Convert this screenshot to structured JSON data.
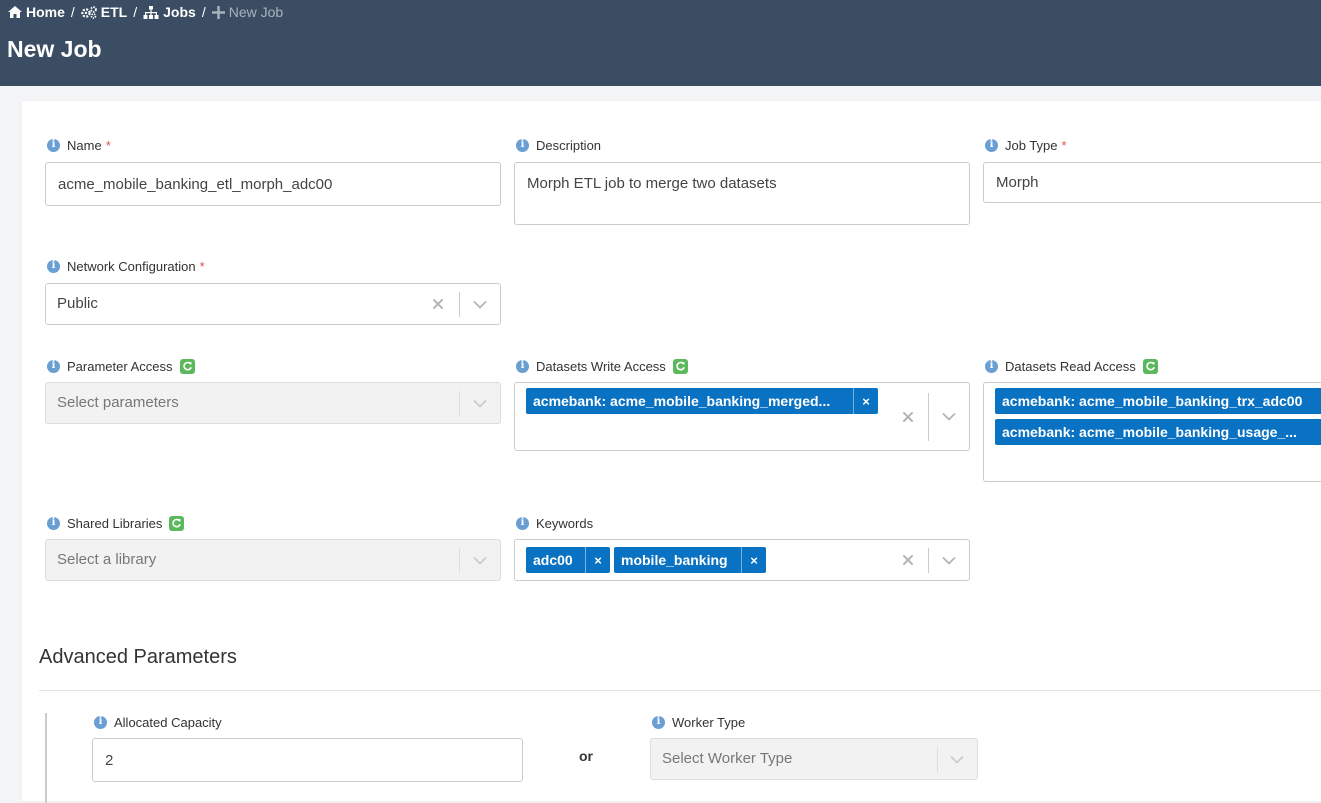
{
  "breadcrumb": {
    "home": "Home",
    "etl": "ETL",
    "jobs": "Jobs",
    "current": "New Job"
  },
  "page_title": "New Job",
  "form": {
    "name": {
      "label": "Name",
      "required_mark": "*",
      "value": "acme_mobile_banking_etl_morph_adc00"
    },
    "description": {
      "label": "Description",
      "value": "Morph ETL job to merge two datasets"
    },
    "job_type": {
      "label": "Job Type",
      "required_mark": "*",
      "value": "Morph"
    },
    "network_configuration": {
      "label": "Network Configuration",
      "required_mark": "*",
      "value": "Public"
    },
    "parameter_access": {
      "label": "Parameter Access",
      "placeholder": "Select parameters"
    },
    "datasets_write_access": {
      "label": "Datasets Write Access",
      "chips": [
        "acmebank: acme_mobile_banking_merged..."
      ]
    },
    "datasets_read_access": {
      "label": "Datasets Read Access",
      "chips": [
        "acmebank: acme_mobile_banking_trx_adc00",
        "acmebank: acme_mobile_banking_usage_..."
      ]
    },
    "shared_libraries": {
      "label": "Shared Libraries",
      "placeholder": "Select a library"
    },
    "keywords": {
      "label": "Keywords",
      "chips": [
        "adc00",
        "mobile_banking"
      ]
    },
    "chip_remove_symbol": "×"
  },
  "advanced": {
    "title": "Advanced Parameters",
    "allocated_capacity": {
      "label": "Allocated Capacity",
      "value": "2"
    },
    "or_text": "or",
    "worker_type": {
      "label": "Worker Type",
      "placeholder": "Select Worker Type"
    }
  },
  "icons": {
    "info": "i",
    "home": "home-icon",
    "etl": "gears-icon",
    "jobs": "sitemap-icon",
    "new": "plus-icon",
    "refresh": "refresh-icon"
  },
  "colors": {
    "header_bg": "#3b4d63",
    "chip_bg": "#0a72c2",
    "info_icon": "#6a9fd4",
    "refresh_icon": "#5cb85c",
    "required": "#d9534f"
  }
}
